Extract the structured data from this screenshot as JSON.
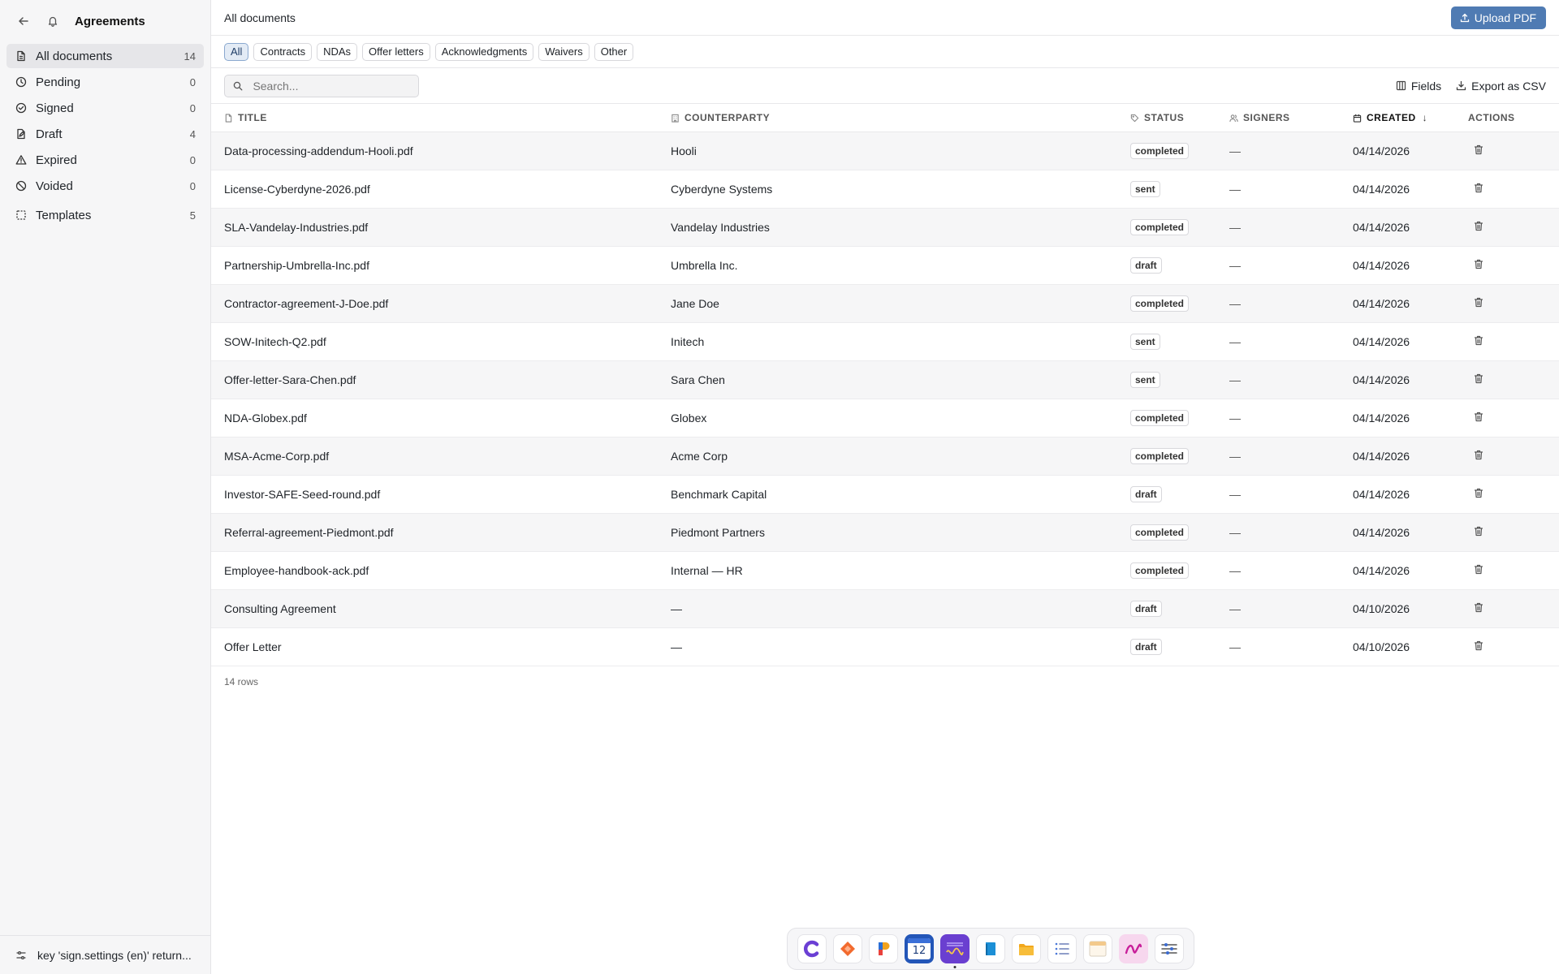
{
  "sidebar": {
    "title": "Agreements",
    "items": [
      {
        "label": "All documents",
        "count": "14"
      },
      {
        "label": "Pending",
        "count": "0"
      },
      {
        "label": "Signed",
        "count": "0"
      },
      {
        "label": "Draft",
        "count": "4"
      },
      {
        "label": "Expired",
        "count": "0"
      },
      {
        "label": "Voided",
        "count": "0"
      }
    ],
    "templates": {
      "label": "Templates",
      "count": "5"
    },
    "footer": {
      "text": "key 'sign.settings (en)' return..."
    }
  },
  "header": {
    "page_title": "All documents",
    "upload_label": "Upload PDF"
  },
  "filters": [
    "All",
    "Contracts",
    "NDAs",
    "Offer letters",
    "Acknowledgments",
    "Waivers",
    "Other"
  ],
  "toolbar": {
    "search_placeholder": "Search...",
    "fields_label": "Fields",
    "export_label": "Export as CSV"
  },
  "table": {
    "columns": {
      "title": "TITLE",
      "counterparty": "COUNTERPARTY",
      "status": "STATUS",
      "signers": "SIGNERS",
      "created": "CREATED",
      "actions": "ACTIONS"
    },
    "sort_indicator": "↓",
    "rows": [
      {
        "title": "Data-processing-addendum-Hooli.pdf",
        "counterparty": "Hooli",
        "status": "completed",
        "signers": "—",
        "created": "04/14/2026"
      },
      {
        "title": "License-Cyberdyne-2026.pdf",
        "counterparty": "Cyberdyne Systems",
        "status": "sent",
        "signers": "—",
        "created": "04/14/2026"
      },
      {
        "title": "SLA-Vandelay-Industries.pdf",
        "counterparty": "Vandelay Industries",
        "status": "completed",
        "signers": "—",
        "created": "04/14/2026"
      },
      {
        "title": "Partnership-Umbrella-Inc.pdf",
        "counterparty": "Umbrella Inc.",
        "status": "draft",
        "signers": "—",
        "created": "04/14/2026"
      },
      {
        "title": "Contractor-agreement-J-Doe.pdf",
        "counterparty": "Jane Doe",
        "status": "completed",
        "signers": "—",
        "created": "04/14/2026"
      },
      {
        "title": "SOW-Initech-Q2.pdf",
        "counterparty": "Initech",
        "status": "sent",
        "signers": "—",
        "created": "04/14/2026"
      },
      {
        "title": "Offer-letter-Sara-Chen.pdf",
        "counterparty": "Sara Chen",
        "status": "sent",
        "signers": "—",
        "created": "04/14/2026"
      },
      {
        "title": "NDA-Globex.pdf",
        "counterparty": "Globex",
        "status": "completed",
        "signers": "—",
        "created": "04/14/2026"
      },
      {
        "title": "MSA-Acme-Corp.pdf",
        "counterparty": "Acme Corp",
        "status": "completed",
        "signers": "—",
        "created": "04/14/2026"
      },
      {
        "title": "Investor-SAFE-Seed-round.pdf",
        "counterparty": "Benchmark Capital",
        "status": "draft",
        "signers": "—",
        "created": "04/14/2026"
      },
      {
        "title": "Referral-agreement-Piedmont.pdf",
        "counterparty": "Piedmont Partners",
        "status": "completed",
        "signers": "—",
        "created": "04/14/2026"
      },
      {
        "title": "Employee-handbook-ack.pdf",
        "counterparty": "Internal — HR",
        "status": "completed",
        "signers": "—",
        "created": "04/14/2026"
      },
      {
        "title": "Consulting Agreement",
        "counterparty": "—",
        "status": "draft",
        "signers": "—",
        "created": "04/10/2026"
      },
      {
        "title": "Offer Letter",
        "counterparty": "—",
        "status": "draft",
        "signers": "—",
        "created": "04/10/2026"
      }
    ],
    "row_count": "14 rows"
  },
  "dock": {
    "calendar_day": "12",
    "apps": [
      "c-app-icon",
      "shape-app-icon",
      "p-app-icon",
      "calendar-icon",
      "waveform-app-icon",
      "book-app-icon",
      "folder-icon",
      "list-app-icon",
      "window-app-icon",
      "scribble-app-icon",
      "settings-sliders-icon"
    ]
  },
  "colors": {
    "accent": "#4f7bb3",
    "active_chip_bg": "#e3ebf5",
    "sidebar_bg": "#f6f6f7"
  }
}
